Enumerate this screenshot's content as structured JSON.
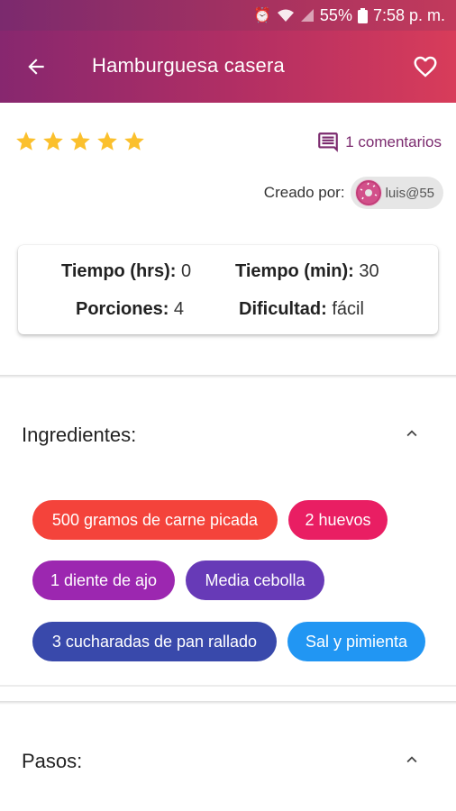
{
  "status_bar": {
    "battery": "55%",
    "time": "7:58 p. m."
  },
  "app_bar": {
    "title": "Hamburguesa casera"
  },
  "rating": {
    "stars": 5,
    "comments_label": "1 comentarios"
  },
  "creator": {
    "label": "Creado por:",
    "username": "luis@55"
  },
  "info": {
    "time_hrs_label": "Tiempo (hrs):",
    "time_hrs_value": "0",
    "time_min_label": "Tiempo (min):",
    "time_min_value": "30",
    "portions_label": "Porciones:",
    "portions_value": "4",
    "difficulty_label": "Dificultad:",
    "difficulty_value": "fácil"
  },
  "ingredients": {
    "title": "Ingredientes:",
    "items": [
      {
        "label": "500 gramos de carne picada",
        "color": "#f4433b"
      },
      {
        "label": "2 huevos",
        "color": "#e91e63"
      },
      {
        "label": "1 diente de ajo",
        "color": "#9c27b0"
      },
      {
        "label": "Media cebolla",
        "color": "#673ab7"
      },
      {
        "label": "3 cucharadas de pan rallado",
        "color": "#3949ab"
      },
      {
        "label": "Sal y pimienta",
        "color": "#2196f3"
      }
    ]
  },
  "steps": {
    "title": "Pasos:"
  },
  "colors": {
    "primary": "#a8325f",
    "star": "#fbc02d",
    "accent_text": "#7b2a6e"
  }
}
